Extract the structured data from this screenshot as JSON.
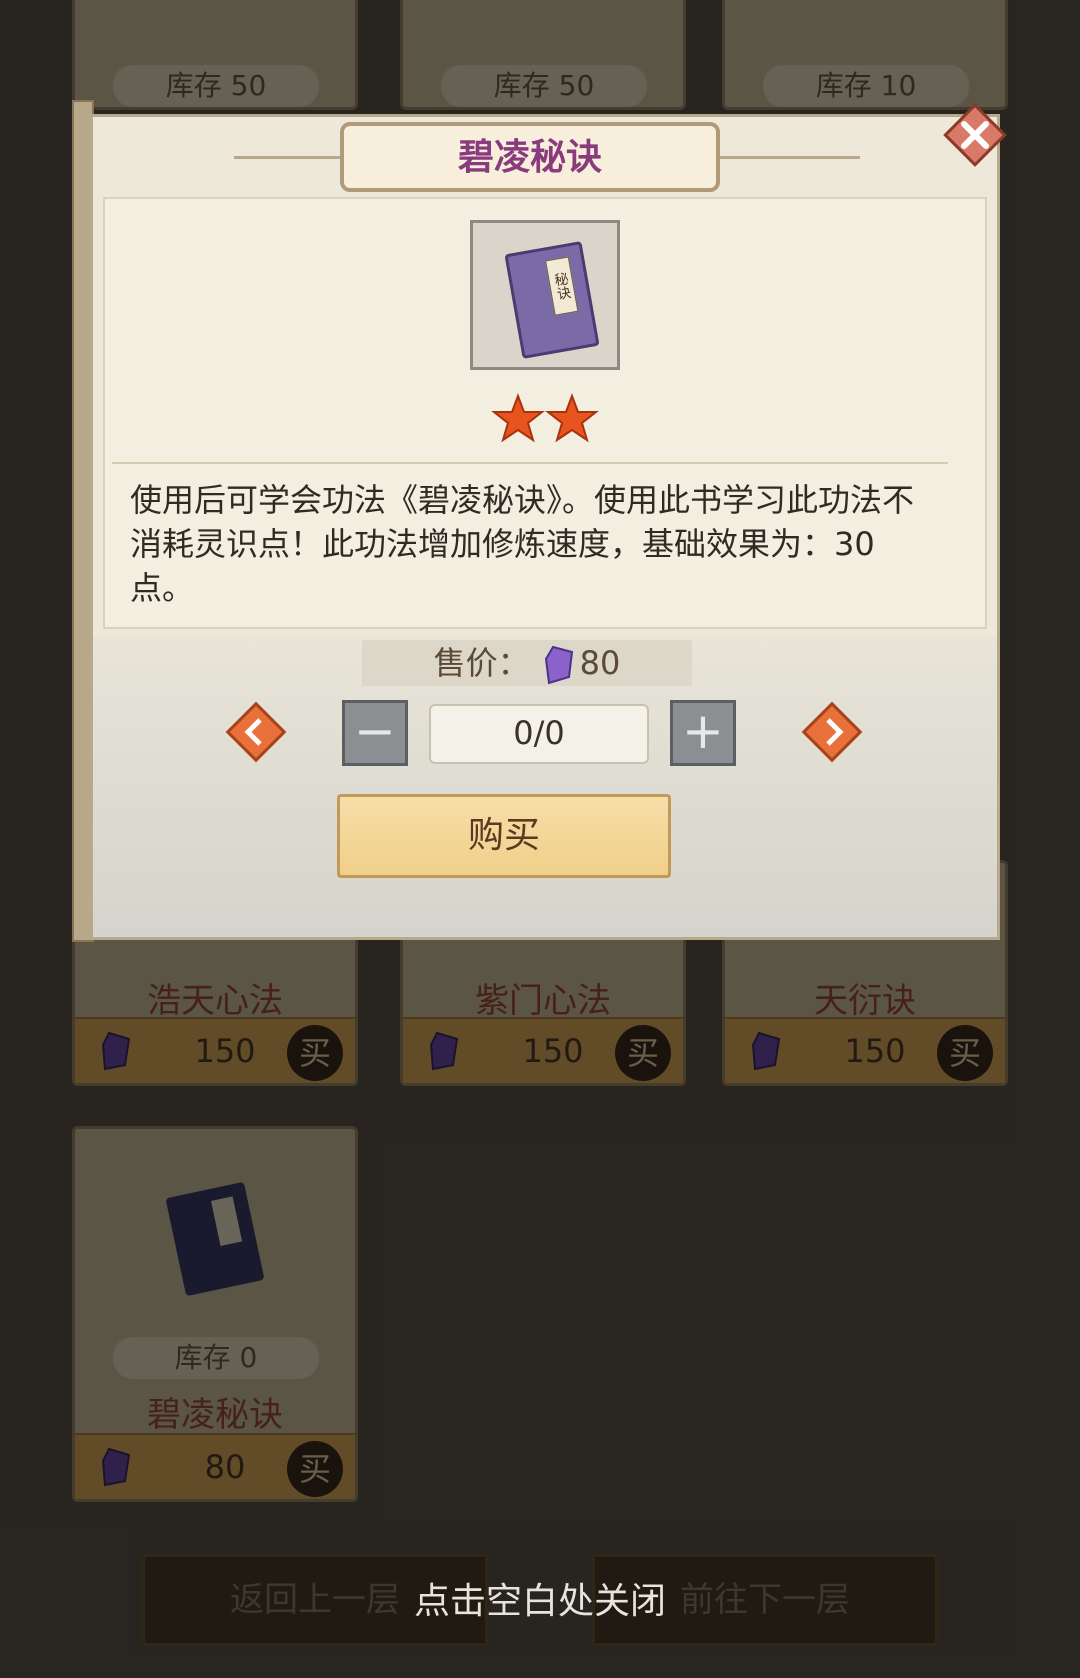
{
  "background": {
    "top_stocks": [
      "库存 50",
      "库存 50",
      "库存 10"
    ],
    "cards": [
      {
        "name": "浩天心法",
        "price": "150",
        "buy": "买"
      },
      {
        "name": "紫门心法",
        "price": "150",
        "buy": "买"
      },
      {
        "name": "天衍诀",
        "price": "150",
        "buy": "买"
      }
    ],
    "last_card": {
      "stock": "库存 0",
      "name": "碧凌秘诀",
      "price": "80",
      "buy": "买"
    },
    "prev_floor": "返回上一层",
    "next_floor": "前往下一层"
  },
  "dialog": {
    "title": "碧凌秘诀",
    "item_icon": "secret-book-icon",
    "book_label": "秘诀",
    "star_count": 2,
    "description": "使用后可学会功法《碧凌秘诀》。使用此书学习此功法不消耗灵识点！此功法增加修炼速度，基础效果为：30点。",
    "price_label": "售价：",
    "price_value": "80",
    "currency_icon": "purple-gem-icon",
    "quantity": "0/0",
    "minus": "−",
    "plus": "+",
    "buy_label": "购买"
  },
  "hint": "点击空白处关闭",
  "colors": {
    "title": "#8a3b7d",
    "gem": "#8a62c8",
    "star": "#e8541e"
  }
}
